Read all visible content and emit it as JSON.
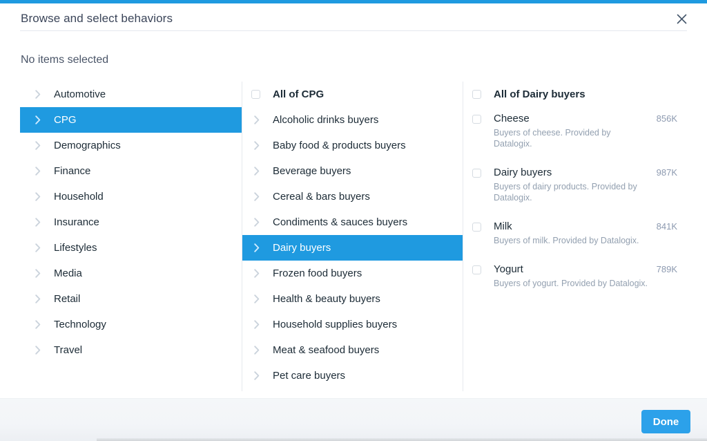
{
  "theme": {
    "accent": "#1f9ae0",
    "button": "#2ca1ea",
    "text": "#1c2b36",
    "muted": "#93a0b0",
    "count": "#8d9ab0"
  },
  "header": {
    "title": "Browse and select behaviors",
    "close_icon": "close-icon"
  },
  "summary": {
    "text": "No items selected"
  },
  "columns": {
    "categories": [
      {
        "label": "Automotive",
        "selected": false
      },
      {
        "label": "CPG",
        "selected": true
      },
      {
        "label": "Demographics",
        "selected": false
      },
      {
        "label": "Finance",
        "selected": false
      },
      {
        "label": "Household",
        "selected": false
      },
      {
        "label": "Insurance",
        "selected": false
      },
      {
        "label": "Lifestyles",
        "selected": false
      },
      {
        "label": "Media",
        "selected": false
      },
      {
        "label": "Retail",
        "selected": false
      },
      {
        "label": "Technology",
        "selected": false
      },
      {
        "label": "Travel",
        "selected": false
      }
    ],
    "subcategories": {
      "all_label": "All of CPG",
      "items": [
        {
          "label": "Alcoholic drinks buyers",
          "selected": false
        },
        {
          "label": "Baby food & products buyers",
          "selected": false
        },
        {
          "label": "Beverage buyers",
          "selected": false
        },
        {
          "label": "Cereal & bars buyers",
          "selected": false
        },
        {
          "label": "Condiments & sauces buyers",
          "selected": false
        },
        {
          "label": "Dairy buyers",
          "selected": true
        },
        {
          "label": "Frozen food buyers",
          "selected": false
        },
        {
          "label": "Health & beauty buyers",
          "selected": false
        },
        {
          "label": "Household supplies buyers",
          "selected": false
        },
        {
          "label": "Meat & seafood buyers",
          "selected": false
        },
        {
          "label": "Pet care buyers",
          "selected": false
        }
      ]
    },
    "details": {
      "all_label": "All of Dairy buyers",
      "items": [
        {
          "label": "Cheese",
          "description": "Buyers of cheese. Provided by Datalogix.",
          "count": "856K",
          "checked": false
        },
        {
          "label": "Dairy buyers",
          "description": "Buyers of dairy products. Provided by Datalogix.",
          "count": "987K",
          "checked": false
        },
        {
          "label": "Milk",
          "description": "Buyers of milk. Provided by Datalogix.",
          "count": "841K",
          "checked": false
        },
        {
          "label": "Yogurt",
          "description": "Buyers of yogurt. Provided by Datalogix.",
          "count": "789K",
          "checked": false
        }
      ]
    }
  },
  "footer": {
    "done_label": "Done"
  }
}
